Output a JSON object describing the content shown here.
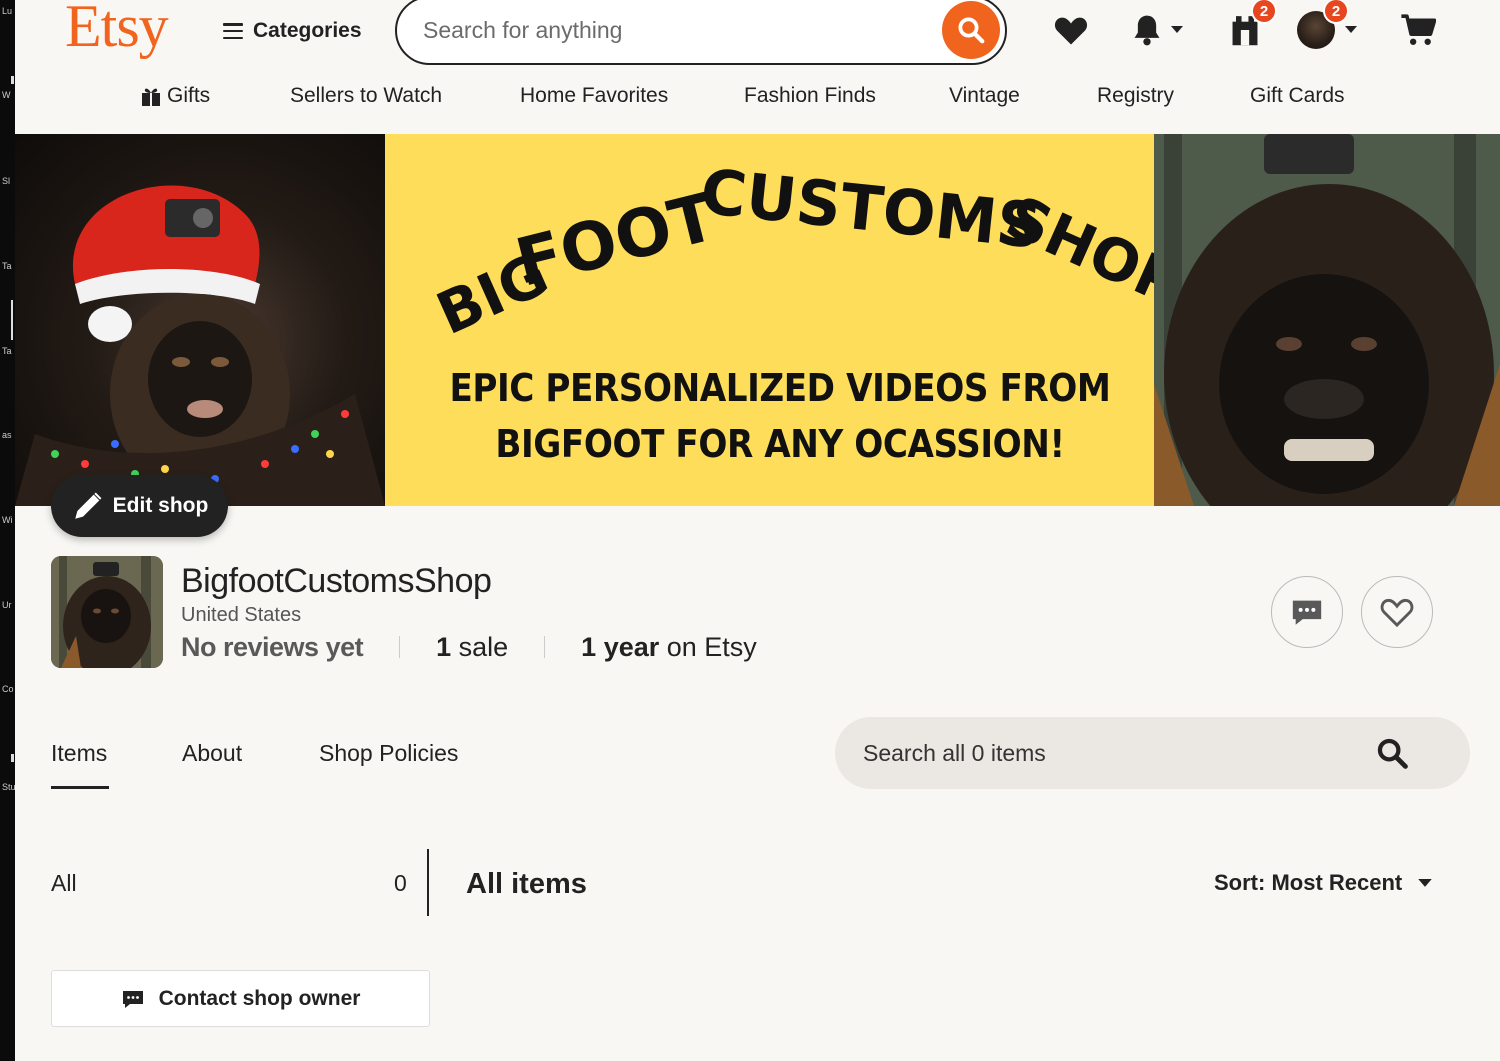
{
  "header": {
    "logo": "Etsy",
    "categories_label": "Categories",
    "search_placeholder": "Search for anything",
    "badges": {
      "registry": "2",
      "account": "2"
    }
  },
  "nav": {
    "items": [
      {
        "label": "Gifts"
      },
      {
        "label": "Sellers to Watch"
      },
      {
        "label": "Home Favorites"
      },
      {
        "label": "Fashion Finds"
      },
      {
        "label": "Vintage"
      },
      {
        "label": "Registry"
      },
      {
        "label": "Gift Cards"
      }
    ]
  },
  "banner": {
    "headline_words": [
      "BIG",
      "FOOT",
      "CUSTOMS",
      "SHOP"
    ],
    "subline_1": "EPIC PERSONALIZED VIDEOS FROM",
    "subline_2": "BIGFOOT FOR ANY OCASSION!"
  },
  "edit_shop_label": "Edit shop",
  "shop": {
    "name": "BigfootCustomsShop",
    "location": "United States",
    "reviews": "No reviews yet",
    "sales_count": "1",
    "sales_label": "sale",
    "years_count": "1 year",
    "years_label": "on Etsy"
  },
  "tabs": [
    {
      "label": "Items",
      "active": true
    },
    {
      "label": "About"
    },
    {
      "label": "Shop Policies"
    }
  ],
  "shop_search_placeholder": "Search all 0 items",
  "sections": {
    "all_label": "All",
    "all_count": "0",
    "title": "All items",
    "sort_label": "Sort: Most Recent"
  },
  "contact_label": "Contact shop owner",
  "left_strip_labels": [
    "Lu",
    "W",
    "Sl",
    "Ta",
    "Ta",
    "as",
    "Wi",
    "Ur",
    "Co",
    "Stu"
  ],
  "colors": {
    "brand": "#f1641e",
    "badge": "#e8461e",
    "banner_bg": "#fedd5a",
    "page_bg": "#f8f7f4"
  }
}
